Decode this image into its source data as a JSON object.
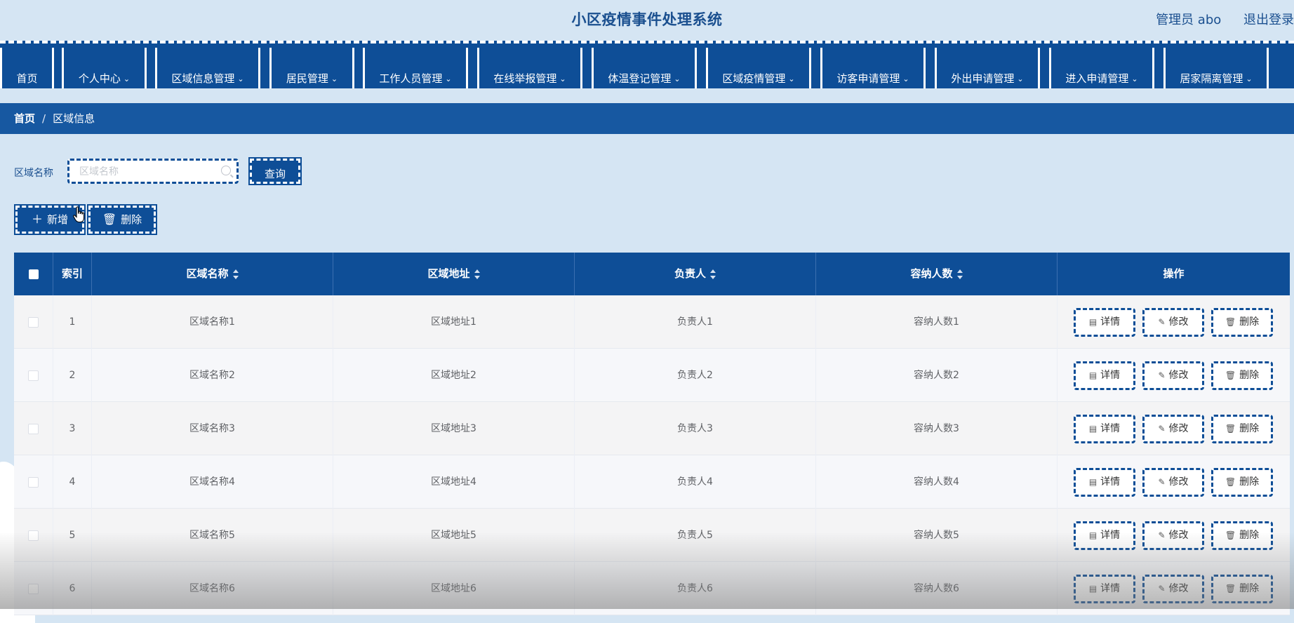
{
  "header": {
    "title": "小区疫情事件处理系统",
    "admin": "管理员 abo",
    "logout": "退出登录"
  },
  "nav": {
    "items": [
      {
        "label": "首页",
        "has_dropdown": false
      },
      {
        "label": "个人中心",
        "has_dropdown": true
      },
      {
        "label": "区域信息管理",
        "has_dropdown": true
      },
      {
        "label": "居民管理",
        "has_dropdown": true
      },
      {
        "label": "工作人员管理",
        "has_dropdown": true
      },
      {
        "label": "在线举报管理",
        "has_dropdown": true
      },
      {
        "label": "体温登记管理",
        "has_dropdown": true
      },
      {
        "label": "区域疫情管理",
        "has_dropdown": true
      },
      {
        "label": "访客申请管理",
        "has_dropdown": true
      },
      {
        "label": "外出申请管理",
        "has_dropdown": true
      },
      {
        "label": "进入申请管理",
        "has_dropdown": true
      },
      {
        "label": "居家隔离管理",
        "has_dropdown": true
      }
    ]
  },
  "breadcrumb": {
    "home": "首页",
    "separator": "/",
    "current": "区域信息"
  },
  "search": {
    "label": "区域名称",
    "placeholder": "区域名称",
    "value": "",
    "button": "查询"
  },
  "actions": {
    "add": "新增",
    "delete": "删除"
  },
  "table": {
    "columns": [
      "索引",
      "区域名称",
      "区域地址",
      "负责人",
      "容纳人数",
      "操作"
    ],
    "rows": [
      {
        "index": "1",
        "name": "区域名称1",
        "address": "区域地址1",
        "manager": "负责人1",
        "capacity": "容纳人数1"
      },
      {
        "index": "2",
        "name": "区域名称2",
        "address": "区域地址2",
        "manager": "负责人2",
        "capacity": "容纳人数2"
      },
      {
        "index": "3",
        "name": "区域名称3",
        "address": "区域地址3",
        "manager": "负责人3",
        "capacity": "容纳人数3"
      },
      {
        "index": "4",
        "name": "区域名称4",
        "address": "区域地址4",
        "manager": "负责人4",
        "capacity": "容纳人数4"
      },
      {
        "index": "5",
        "name": "区域名称5",
        "address": "区域地址5",
        "manager": "负责人5",
        "capacity": "容纳人数5"
      },
      {
        "index": "6",
        "name": "区域名称6",
        "address": "区域地址6",
        "manager": "负责人6",
        "capacity": "容纳人数6"
      }
    ],
    "row_actions": {
      "detail": "详情",
      "edit": "修改",
      "delete": "删除"
    }
  },
  "colors": {
    "primary": "#0e4e97",
    "background": "#d5e5f3",
    "breadcrumb": "#1758a1",
    "title": "#1a4f8f"
  }
}
